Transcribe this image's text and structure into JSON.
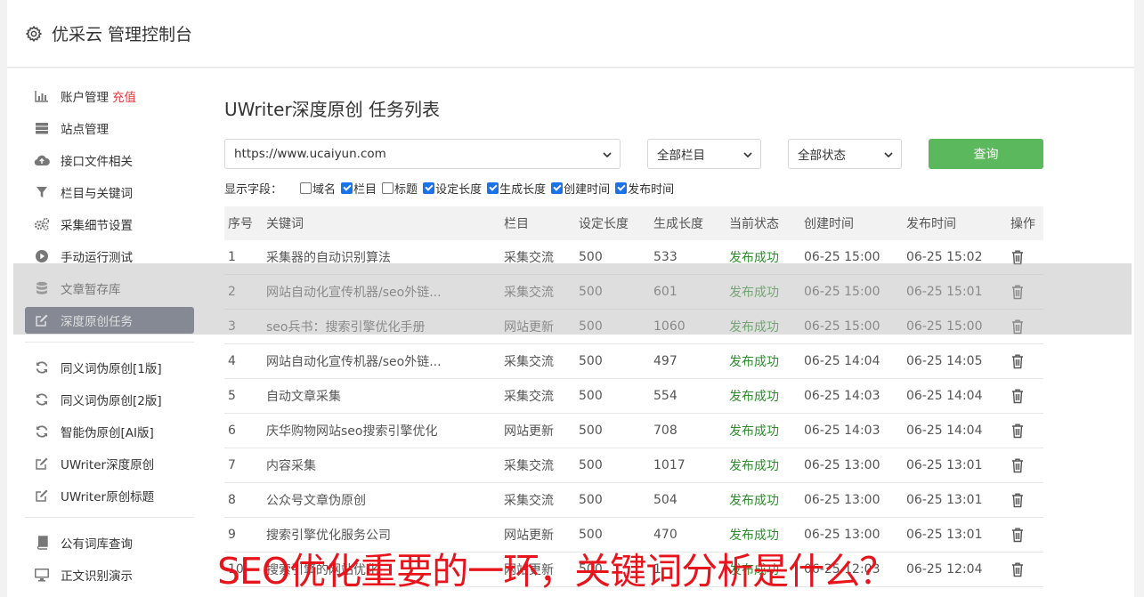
{
  "app": {
    "title": "优采云 管理控制台"
  },
  "sidebar": {
    "group1": [
      {
        "label": "账户管理",
        "tag": "充值",
        "icon": "bar-chart-icon"
      },
      {
        "label": "站点管理",
        "icon": "server-icon"
      },
      {
        "label": "接口文件相关",
        "icon": "cloud-upload-icon"
      },
      {
        "label": "栏目与关键词",
        "icon": "filter-icon"
      },
      {
        "label": "采集细节设置",
        "icon": "gears-icon"
      },
      {
        "label": "手动运行测试",
        "icon": "play-circle-icon"
      },
      {
        "label": "文章暂存库",
        "icon": "database-icon"
      },
      {
        "label": "深度原创任务",
        "icon": "edit-icon",
        "active": true
      }
    ],
    "group2": [
      {
        "label": "同义词伪原创[1版]",
        "icon": "refresh-icon"
      },
      {
        "label": "同义词伪原创[2版]",
        "icon": "refresh-icon"
      },
      {
        "label": "智能伪原创[AI版]",
        "icon": "refresh-icon"
      },
      {
        "label": "UWriter深度原创",
        "icon": "edit-icon"
      },
      {
        "label": "UWriter原创标题",
        "icon": "edit-icon"
      }
    ],
    "group3": [
      {
        "label": "公有词库查询",
        "icon": "book-icon"
      },
      {
        "label": "正文识别演示",
        "icon": "monitor-icon"
      }
    ]
  },
  "page": {
    "title": "UWriter深度原创 任务列表"
  },
  "filters": {
    "site": "https://www.ucaiyun.com",
    "column": "全部栏目",
    "status": "全部状态",
    "query_label": "查询"
  },
  "fields": {
    "label": "显示字段：",
    "options": [
      {
        "label": "域名",
        "checked": false
      },
      {
        "label": "栏目",
        "checked": true
      },
      {
        "label": "标题",
        "checked": false
      },
      {
        "label": "设定长度",
        "checked": true
      },
      {
        "label": "生成长度",
        "checked": true
      },
      {
        "label": "创建时间",
        "checked": true
      },
      {
        "label": "发布时间",
        "checked": true
      }
    ]
  },
  "table": {
    "headers": [
      "序号",
      "关键词",
      "栏目",
      "设定长度",
      "生成长度",
      "当前状态",
      "创建时间",
      "发布时间",
      "操作"
    ],
    "rows": [
      [
        "1",
        "采集器的自动识别算法",
        "采集交流",
        "500",
        "533",
        "发布成功",
        "06-25 15:00",
        "06-25 15:02"
      ],
      [
        "2",
        "网站自动化宣传机器/seo外链...",
        "采集交流",
        "500",
        "601",
        "发布成功",
        "06-25 15:00",
        "06-25 15:01"
      ],
      [
        "3",
        "seo兵书：搜索引擎优化手册",
        "网站更新",
        "500",
        "1060",
        "发布成功",
        "06-25 15:00",
        "06-25 15:00"
      ],
      [
        "4",
        "网站自动化宣传机器/seo外链...",
        "采集交流",
        "500",
        "497",
        "发布成功",
        "06-25 14:04",
        "06-25 14:05"
      ],
      [
        "5",
        "自动文章采集",
        "采集交流",
        "500",
        "554",
        "发布成功",
        "06-25 14:03",
        "06-25 14:04"
      ],
      [
        "6",
        "庆华购物网站seo搜索引擎优化",
        "网站更新",
        "500",
        "708",
        "发布成功",
        "06-25 14:03",
        "06-25 14:04"
      ],
      [
        "7",
        "内容采集",
        "采集交流",
        "500",
        "1017",
        "发布成功",
        "06-25 13:00",
        "06-25 13:01"
      ],
      [
        "8",
        "公众号文章伪原创",
        "采集交流",
        "500",
        "504",
        "发布成功",
        "06-25 13:00",
        "06-25 13:01"
      ],
      [
        "9",
        "搜索引擎优化服务公司",
        "网站更新",
        "500",
        "470",
        "发布成功",
        "06-25 13:00",
        "06-25 13:01"
      ],
      [
        "10",
        "搜索引擎的网站优化",
        "网站更新",
        "500",
        "1",
        "发布成功",
        "06-25 12:03",
        "06-25 12:04"
      ]
    ]
  },
  "caption": "SEO优化重要的一环，关键词分析是什么？"
}
